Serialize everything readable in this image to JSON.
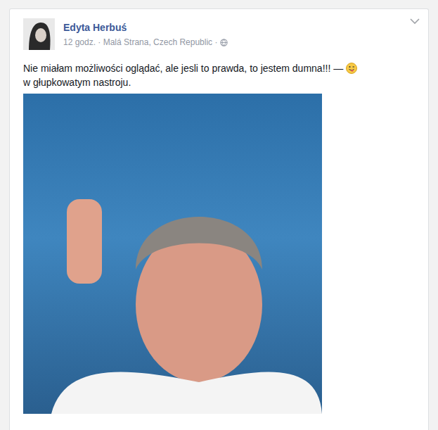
{
  "author": {
    "name": "Edyta Herbuś"
  },
  "meta": "12 godz. · Malá Strana, Czech Republic ·",
  "post": {
    "text": "Nie miałam możliwości oglądać, ale jesli to prawda, to jestem dumna!!! —",
    "feeling": "w głupkowatym nastroju."
  }
}
